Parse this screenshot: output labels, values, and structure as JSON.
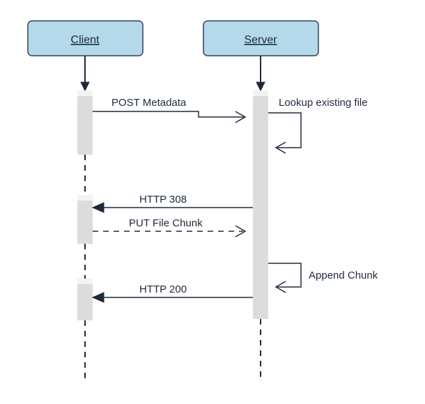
{
  "colors": {
    "participantFill": "#b3d9ea",
    "stroke": "#1e293b",
    "activation": "#dcdcdc"
  },
  "participants": {
    "client": {
      "label": "Client"
    },
    "server": {
      "label": "Server"
    }
  },
  "messages": {
    "post_metadata": {
      "label": "POST Metadata",
      "from": "client",
      "to": "server",
      "style": "solid",
      "arrow": "open"
    },
    "lookup": {
      "label": "Lookup existing file",
      "from": "server",
      "to": "server",
      "style": "solid",
      "arrow": "open"
    },
    "http_308": {
      "label": "HTTP 308",
      "from": "server",
      "to": "client",
      "style": "solid",
      "arrow": "closed"
    },
    "put_chunk": {
      "label": "PUT File Chunk",
      "from": "client",
      "to": "server",
      "style": "dashed",
      "arrow": "open"
    },
    "append_chunk": {
      "label": "Append Chunk",
      "from": "server",
      "to": "server",
      "style": "solid",
      "arrow": "open"
    },
    "http_200": {
      "label": "HTTP 200",
      "from": "server",
      "to": "client",
      "style": "solid",
      "arrow": "closed"
    }
  }
}
